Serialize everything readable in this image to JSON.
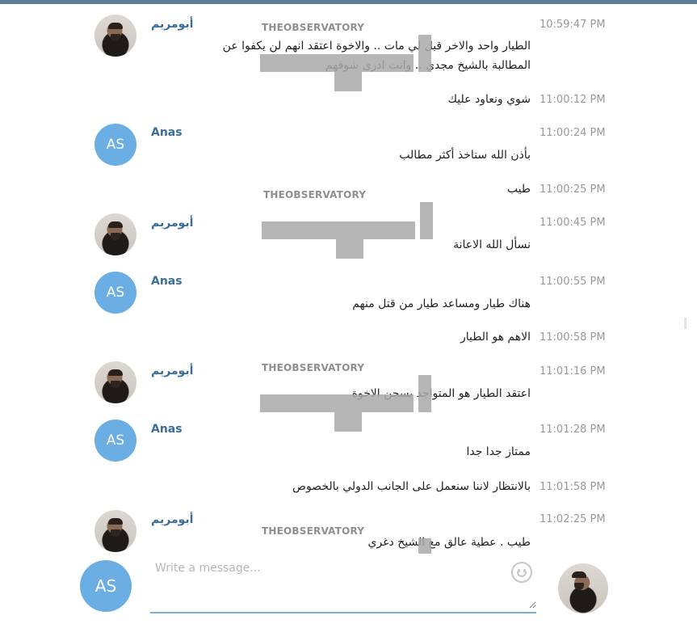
{
  "messages": [
    {
      "sender": "أبومريم",
      "avatar": "photo",
      "time": "10:59:47 PM",
      "lines": [
        "الطيار واحد والاخر قبل لي مات .. والاخوة اعتقد انهم لن يكفوا عن",
        "المطالبة بالشيخ مجدي .. وانت ادرى شوفهم"
      ]
    },
    {
      "sender": "",
      "avatar": "",
      "time": "11:00:12 PM",
      "lines": [
        "شوي ونعاود عليك"
      ]
    },
    {
      "sender": "Anas",
      "avatar": "AS",
      "time": "11:00:24 PM",
      "lines": [
        "بأذن الله سناخذ أكثر مطالب"
      ]
    },
    {
      "sender": "",
      "avatar": "",
      "time": "11:00:25 PM",
      "lines": [
        "طيب"
      ]
    },
    {
      "sender": "أبومريم",
      "avatar": "photo",
      "time": "11:00:45 PM",
      "lines": [
        "نسأل الله الاعانة"
      ]
    },
    {
      "sender": "Anas",
      "avatar": "AS",
      "time": "11:00:55 PM",
      "lines": [
        "هناك طيار ومساعد طيار من قتل منهم"
      ]
    },
    {
      "sender": "",
      "avatar": "",
      "time": "11:00:58 PM",
      "lines": [
        "الاهم هو الطيار"
      ]
    },
    {
      "sender": "أبومريم",
      "avatar": "photo",
      "time": "11:01:16 PM",
      "lines": [
        "اعتقد الطيار هو المتواجد بسجن الاخوة"
      ]
    },
    {
      "sender": "Anas",
      "avatar": "AS",
      "time": "11:01:28 PM",
      "lines": [
        "ممتاز جدا جدا"
      ]
    },
    {
      "sender": "",
      "avatar": "",
      "time": "11:01:58 PM",
      "lines": [
        "بالانتظار لاننا سنعمل على الجانب الدولي بالخصوص"
      ]
    },
    {
      "sender": "أبومريم",
      "avatar": "photo",
      "time": "11:02:25 PM",
      "lines": [
        "طيب . عطية عالق مع الشيخ دغري"
      ]
    }
  ],
  "watermark": {
    "top_text_light": "THE",
    "top_text_bold": "OBSERVATORY"
  },
  "composer": {
    "placeholder": "Write a message...",
    "my_avatar_initials": "AS",
    "emoji_icon": "smiley-icon"
  },
  "colors": {
    "topbar": "#5c7e9b",
    "sender_name": "#3a6d99",
    "avatar_bg": "#6aaee3",
    "timestamp": "#999999",
    "input_underline": "#78aee0"
  }
}
